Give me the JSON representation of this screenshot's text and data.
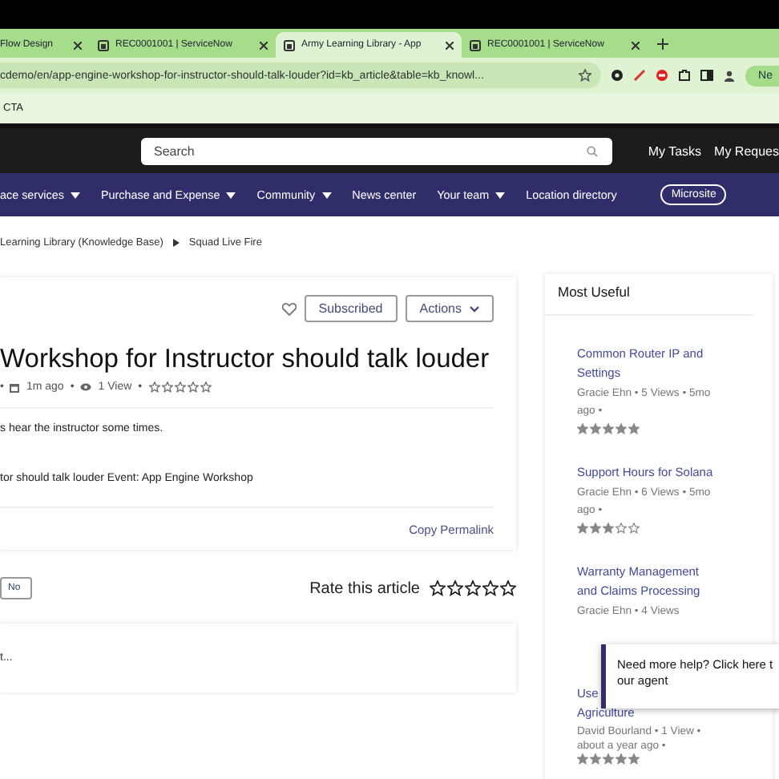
{
  "browser": {
    "tabs": [
      {
        "title": "Flow Design",
        "selected": false
      },
      {
        "title": "REC0001001 | ServiceNow",
        "selected": false
      },
      {
        "title": "Army Learning Library - App",
        "selected": true
      },
      {
        "title": "REC0001001 | ServiceNow",
        "selected": false
      }
    ],
    "address": "cdemo/en/app-engine-workshop-for-instructor-should-talk-louder?id=kb_article&table=kb_knowl...",
    "profile_button": "Ne",
    "bookmarks": [
      "CTA"
    ]
  },
  "header": {
    "search": {
      "placeholder": "Search"
    },
    "links": [
      "My Tasks",
      "My Reques"
    ]
  },
  "nav": {
    "items": [
      {
        "label": "ace services",
        "dropdown": true
      },
      {
        "label": "Purchase and Expense",
        "dropdown": true
      },
      {
        "label": "Community",
        "dropdown": true
      },
      {
        "label": "News center",
        "dropdown": false
      },
      {
        "label": "Your team",
        "dropdown": true
      },
      {
        "label": "Location directory",
        "dropdown": false
      }
    ],
    "microsite": "Microsite"
  },
  "breadcrumbs": [
    "Learning Library (Knowledge Base)",
    "Squad Live Fire"
  ],
  "article": {
    "subscribe": "Subscribed",
    "actions": "Actions",
    "title": "Workshop for Instructor should talk louder",
    "separator": "•",
    "age": "1m ago",
    "views": "1 View",
    "stars": 0,
    "paragraphs": [
      "s hear the instructor some times.",
      "tor should talk louder Event: App Engine Workshop"
    ],
    "permalink": "Copy Permalink"
  },
  "feedback": {
    "no_button": "No",
    "rate_label": "Rate this article",
    "stars": 0
  },
  "comment": {
    "placeholder": "t..."
  },
  "sidebar": {
    "title": "Most Useful",
    "articles": [
      {
        "title": [
          "Common Router IP and Settings"
        ],
        "meta": "Gracie Ehn • 5 Views • 5mo ago •",
        "stars": 5
      },
      {
        "title": [
          "Support Hours for Solana"
        ],
        "meta": "Gracie Ehn • 6 Views • 5mo ago •",
        "stars": 3
      },
      {
        "title": [
          "Warranty Management and Claims Processing"
        ],
        "meta": "Gracie Ehn • 4 Views"
      },
      {
        "title": [
          "Use",
          "Agriculture"
        ],
        "meta": "David Bourland • 1 View • about a year ago •",
        "stars": 5
      }
    ]
  },
  "chat_popup": {
    "lines": [
      "Need more help? Click here t",
      "our agent"
    ]
  }
}
